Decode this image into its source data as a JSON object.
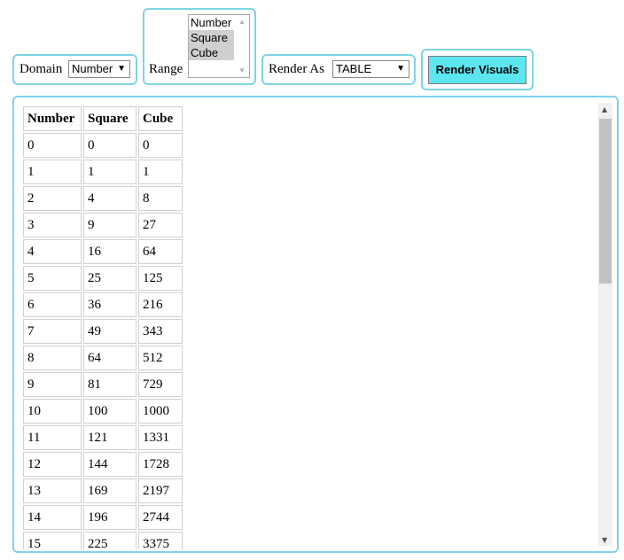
{
  "controls": {
    "domain": {
      "label": "Domain",
      "value": "Number"
    },
    "range": {
      "label": "Range",
      "options": [
        "Number",
        "Square",
        "Cube"
      ],
      "selected": [
        "Square",
        "Cube"
      ]
    },
    "render_as": {
      "label": "Render As",
      "value": "TABLE"
    },
    "render_button": "Render Visuals"
  },
  "table": {
    "headers": [
      "Number",
      "Square",
      "Cube"
    ],
    "rows": [
      [
        "0",
        "0",
        "0"
      ],
      [
        "1",
        "1",
        "1"
      ],
      [
        "2",
        "4",
        "8"
      ],
      [
        "3",
        "9",
        "27"
      ],
      [
        "4",
        "16",
        "64"
      ],
      [
        "5",
        "25",
        "125"
      ],
      [
        "6",
        "36",
        "216"
      ],
      [
        "7",
        "49",
        "343"
      ],
      [
        "8",
        "64",
        "512"
      ],
      [
        "9",
        "81",
        "729"
      ],
      [
        "10",
        "100",
        "1000"
      ],
      [
        "11",
        "121",
        "1331"
      ],
      [
        "12",
        "144",
        "1728"
      ],
      [
        "13",
        "169",
        "2197"
      ],
      [
        "14",
        "196",
        "2744"
      ],
      [
        "15",
        "225",
        "3375"
      ]
    ]
  },
  "colors": {
    "border": "#7fd3e6",
    "button_bg": "#5ce6f0"
  },
  "icons": {
    "dropdown": "triangle-down",
    "scroll_up": "triangle-up",
    "scroll_down": "triangle-down"
  }
}
